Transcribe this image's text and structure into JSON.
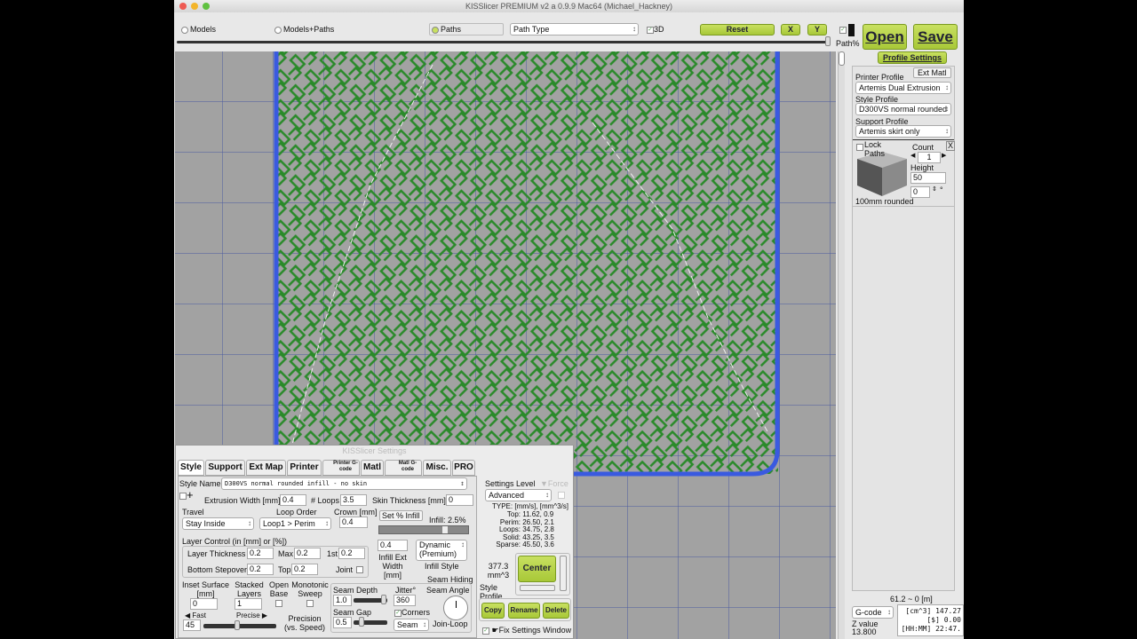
{
  "window": {
    "title": "KISSlicer PREMIUM v2 a 0.9.9 Mac64 (Michael_Hackney)"
  },
  "toolbar": {
    "models": "Models",
    "models_paths": "Models+Paths",
    "paths": "Paths",
    "path_type": "Path Type",
    "three_d": "3D",
    "reset": "Reset",
    "x": "X",
    "y": "Y",
    "path_pct": "Path%",
    "open": "Open",
    "save": "Save"
  },
  "right_panel": {
    "profile_settings": "Profile Settings",
    "ext_matl": "Ext Matl",
    "printer_profile_label": "Printer Profile",
    "printer_profile": "Artemis Dual Extrusion",
    "style_profile_label": "Style Profile",
    "style_profile": "D300VS normal rounded",
    "support_profile_label": "Support Profile",
    "support_profile": "Artemis skirt only",
    "lock_paths": "Lock Paths",
    "count_label": "Count",
    "count": "1",
    "close": "X",
    "height_label": "Height",
    "height": "50",
    "rotation": "0",
    "rotation_unit": "°",
    "model_name": "100mm rounded",
    "length": "61.2 ~ 0 [m]",
    "output_select": "G-code",
    "z_label": "Z value",
    "z_value": "13.800",
    "stats": [
      "[cm^3] 147.27",
      "[$] 0.00",
      "[HH:MM] 22:47."
    ]
  },
  "settings": {
    "title": "KISSlicer Settings",
    "tabs": [
      "Style",
      "Support",
      "Ext Map",
      "Printer",
      "Printer G-code",
      "Matl",
      "Matl G-code",
      "Misc.",
      "PRO"
    ],
    "style_name_label": "Style Name",
    "style_name": "D300VS normal rounded infill - no skin",
    "extrusion_width_label": "Extrusion Width [mm]",
    "extrusion_width": "0.4",
    "loops_label": "# Loops",
    "loops": "3.5",
    "skin_label": "Skin Thickness [mm]",
    "skin": "0",
    "travel_label": "Travel",
    "travel": "Stay Inside",
    "loop_order_label": "Loop Order",
    "loop_order": "Loop1 > Perim",
    "crown_label": "Crown [mm]",
    "crown": "0.4",
    "set_infill": "Set % Infill",
    "infill_label": "Infill: 2.5%",
    "infill_pct": 2.5,
    "layer_control_label": "Layer Control (in [mm] or [%])",
    "layer_thickness_label": "Layer Thickness",
    "layer_thickness": "0.2",
    "max_label": "Max",
    "max": "0.2",
    "first_label": "1st",
    "first": "0.2",
    "bottom_stepover_label": "Bottom Stepover",
    "bottom_stepover": "0.2",
    "top_label": "Top",
    "top": "0.2",
    "joint_label": "Joint",
    "infill_ext_width": "0.4",
    "infill_ext_width_label": "Infill Ext Width [mm]",
    "infill_style": "Dynamic (Premium)",
    "infill_style_label": "Infill Style",
    "inset_label": "Inset Surface [mm]",
    "inset": "0",
    "stacked_label": "Stacked Layers",
    "stacked": "1",
    "open_base_label": "Open Base",
    "monotonic_label": "Monotonic Sweep",
    "fast_label": "◀ Fast",
    "precise_label": "Precise ▶",
    "precision_value": "45",
    "precision_label": "Precision (vs. Speed)",
    "seam_hiding_label": "Seam Hiding",
    "seam_depth_label": "Seam Depth",
    "seam_depth": "1.0",
    "jitter_label": "Jitter°",
    "jitter": "360",
    "seam_angle_label": "Seam Angle",
    "seam_gap_label": "Seam Gap",
    "seam_gap": "0.5",
    "corners_label": "Corners",
    "seam_select": "Seam",
    "join_loop_label": "Join-Loop",
    "settings_level_label": "Settings Level",
    "force_label": "Force",
    "settings_level": "Advanced",
    "type_header": "TYPE: [mm/s], [mm^3/s]",
    "speeds": [
      [
        "Top:",
        "11.62,  0.9"
      ],
      [
        "Perim:",
        "26.50,  2.1"
      ],
      [
        "Loops:",
        "34.75,  2.8"
      ],
      [
        "Solid:",
        "43.25,  3.5"
      ],
      [
        "Sparse:",
        "45.50,  3.6"
      ]
    ],
    "volume": "377.3 mm^3",
    "center": "Center",
    "style_profile_label": "Style Profile",
    "copy": "Copy",
    "rename": "Rename",
    "delete": "Delete",
    "fix_window": "Fix Settings Window"
  },
  "colors": {
    "accent_green": "#b4d044",
    "path_green": "#2a8a2a",
    "perimeter_blue": "#3a5ae0",
    "canvas_gray": "#a2a2a2"
  }
}
